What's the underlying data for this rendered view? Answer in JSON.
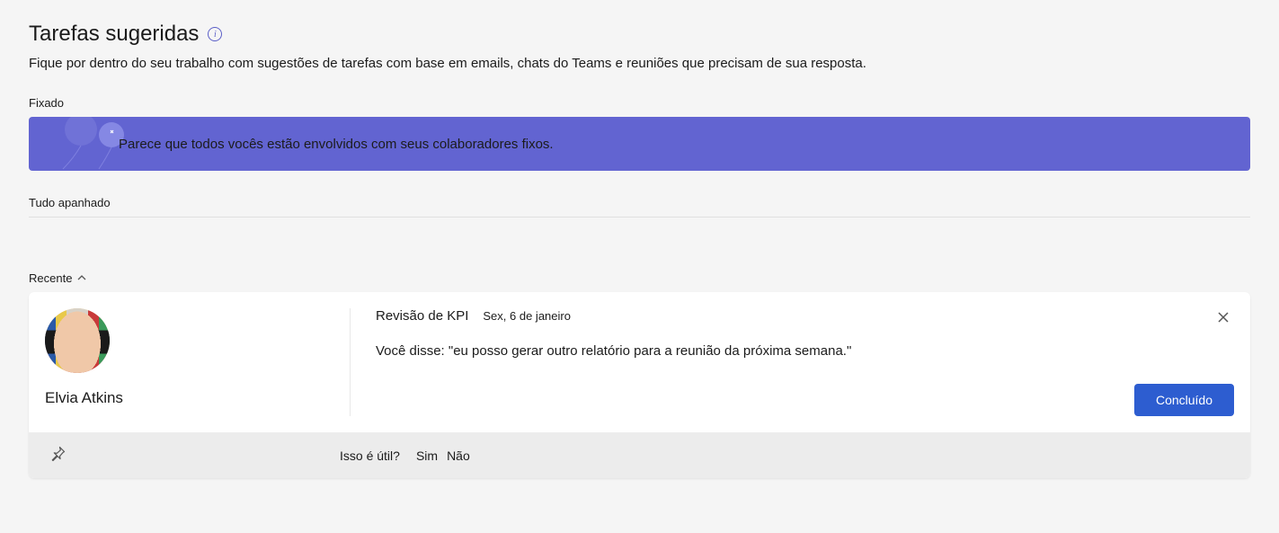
{
  "header": {
    "title": "Tarefas sugeridas",
    "subtitle": "Fique por dentro do seu trabalho com sugestões de tarefas com base em emails, chats do Teams e reuniões que precisam de sua resposta."
  },
  "sections": {
    "pinned_label": "Fixado",
    "pinned_banner_text": "Parece que todos vocês estão envolvidos com seus colaboradores fixos.",
    "caught_up_label": "Tudo apanhado",
    "recent_label": "Recente"
  },
  "card": {
    "person_name": "Elvia Atkins",
    "task_title": "Revisão de KPI",
    "task_date": "Sex, 6 de janeiro",
    "task_body": "Você disse: \"eu posso gerar outro relatório para a reunião da próxima semana.\"",
    "done_label": "Concluído"
  },
  "feedback": {
    "prompt": "Isso é útil?",
    "yes": "Sim",
    "no": "Não"
  }
}
